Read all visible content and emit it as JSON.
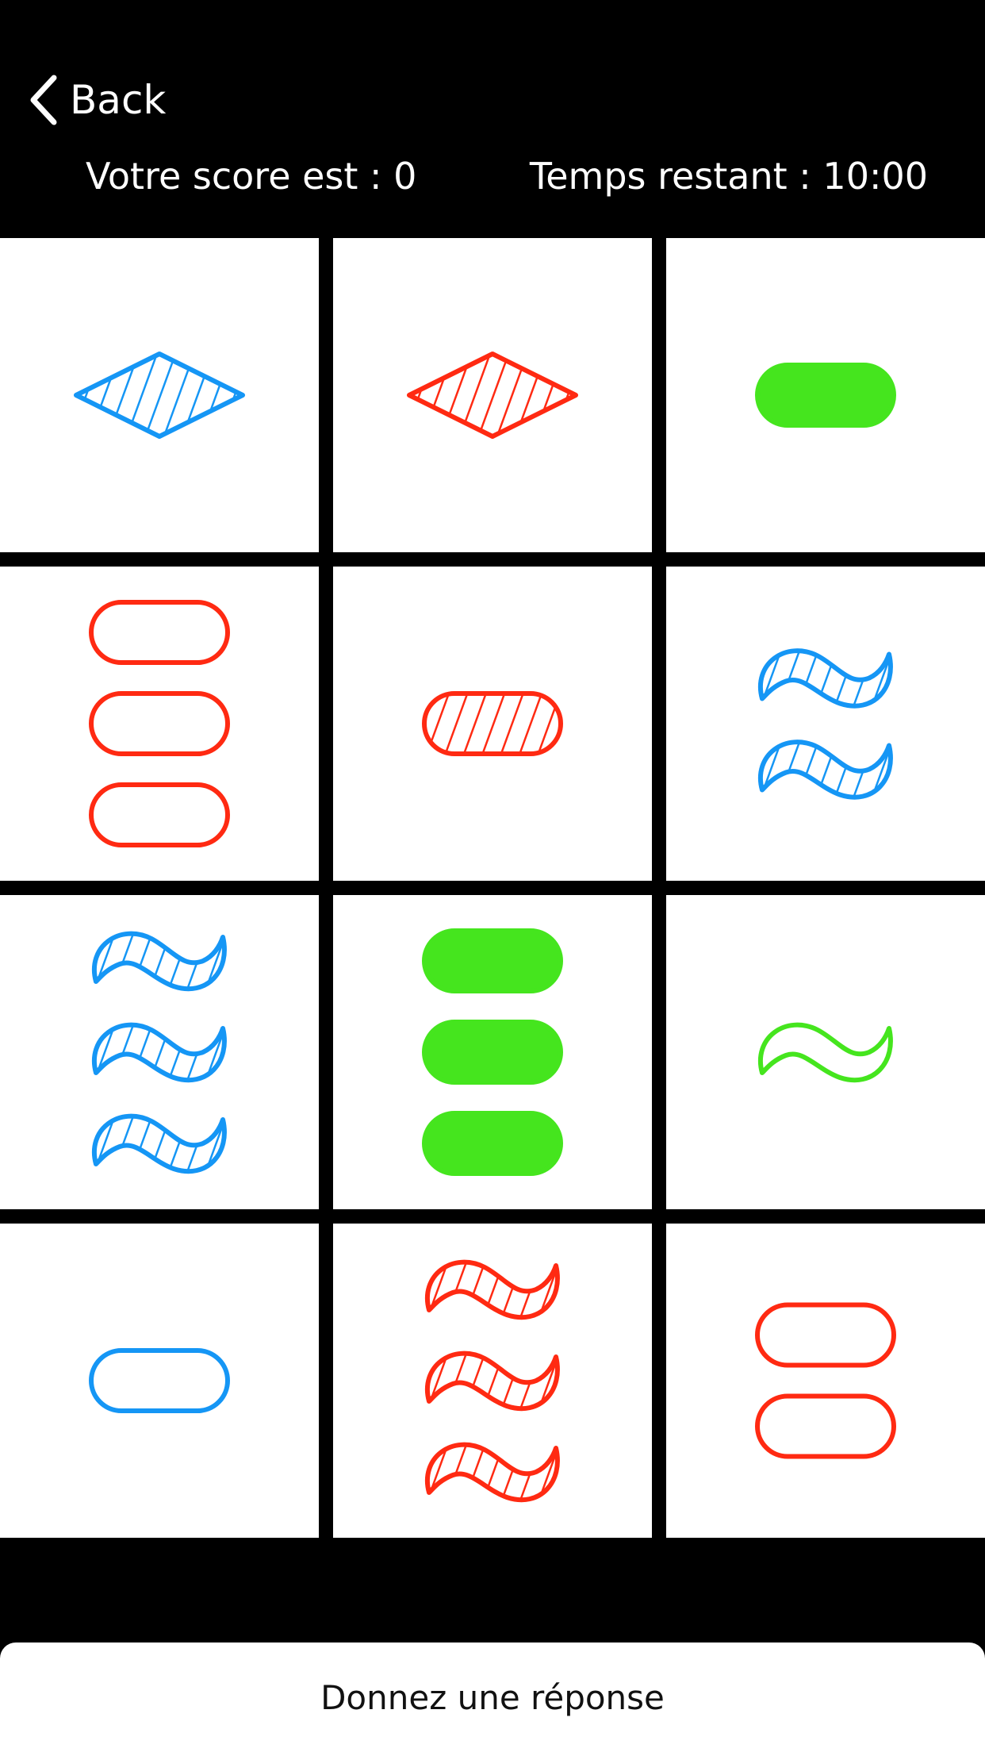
{
  "nav": {
    "back_label": "Back"
  },
  "header": {
    "score_text": "Votre score est : 0",
    "timer_text": "Temps restant : 10:00"
  },
  "colors": {
    "red": "#ff2a12",
    "green": "#45e51e",
    "blue": "#1596f5"
  },
  "cards": [
    {
      "count": 1,
      "shape": "diamond",
      "color": "blue",
      "fill": "striped"
    },
    {
      "count": 1,
      "shape": "diamond",
      "color": "red",
      "fill": "striped"
    },
    {
      "count": 1,
      "shape": "oval",
      "color": "green",
      "fill": "solid"
    },
    {
      "count": 3,
      "shape": "oval",
      "color": "red",
      "fill": "empty"
    },
    {
      "count": 1,
      "shape": "oval",
      "color": "red",
      "fill": "striped"
    },
    {
      "count": 2,
      "shape": "squiggle",
      "color": "blue",
      "fill": "striped"
    },
    {
      "count": 3,
      "shape": "squiggle",
      "color": "blue",
      "fill": "striped"
    },
    {
      "count": 3,
      "shape": "oval",
      "color": "green",
      "fill": "solid"
    },
    {
      "count": 1,
      "shape": "squiggle",
      "color": "green",
      "fill": "empty"
    },
    {
      "count": 1,
      "shape": "oval",
      "color": "blue",
      "fill": "empty"
    },
    {
      "count": 3,
      "shape": "squiggle",
      "color": "red",
      "fill": "striped"
    },
    {
      "count": 2,
      "shape": "oval",
      "color": "red",
      "fill": "empty"
    }
  ],
  "answer_button_label": "Donnez une réponse"
}
